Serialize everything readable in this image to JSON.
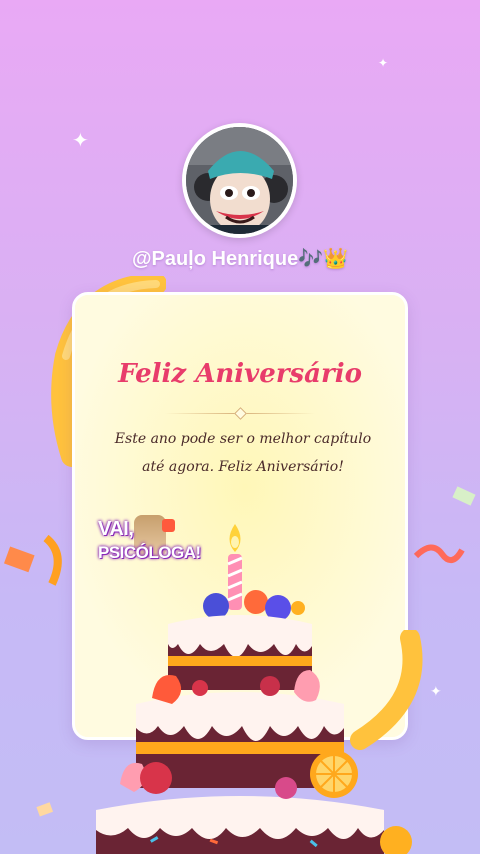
{
  "profile": {
    "username": "@Pauļo Henrique🎶👑"
  },
  "card": {
    "title": "Feliz Aniversário",
    "message": "Este ano pode ser o melhor capítulo até agora. Feliz Aniversário!"
  },
  "sticker": {
    "text_line1": "VAI,",
    "text_line2": "PSICÓLOGA!"
  },
  "colors": {
    "background_top": "#e9a9f5",
    "background_bottom": "#c3bdf5",
    "card_bg": "#fffbe0",
    "title": "#e83c6b",
    "ribbon": "#ffc23d"
  }
}
